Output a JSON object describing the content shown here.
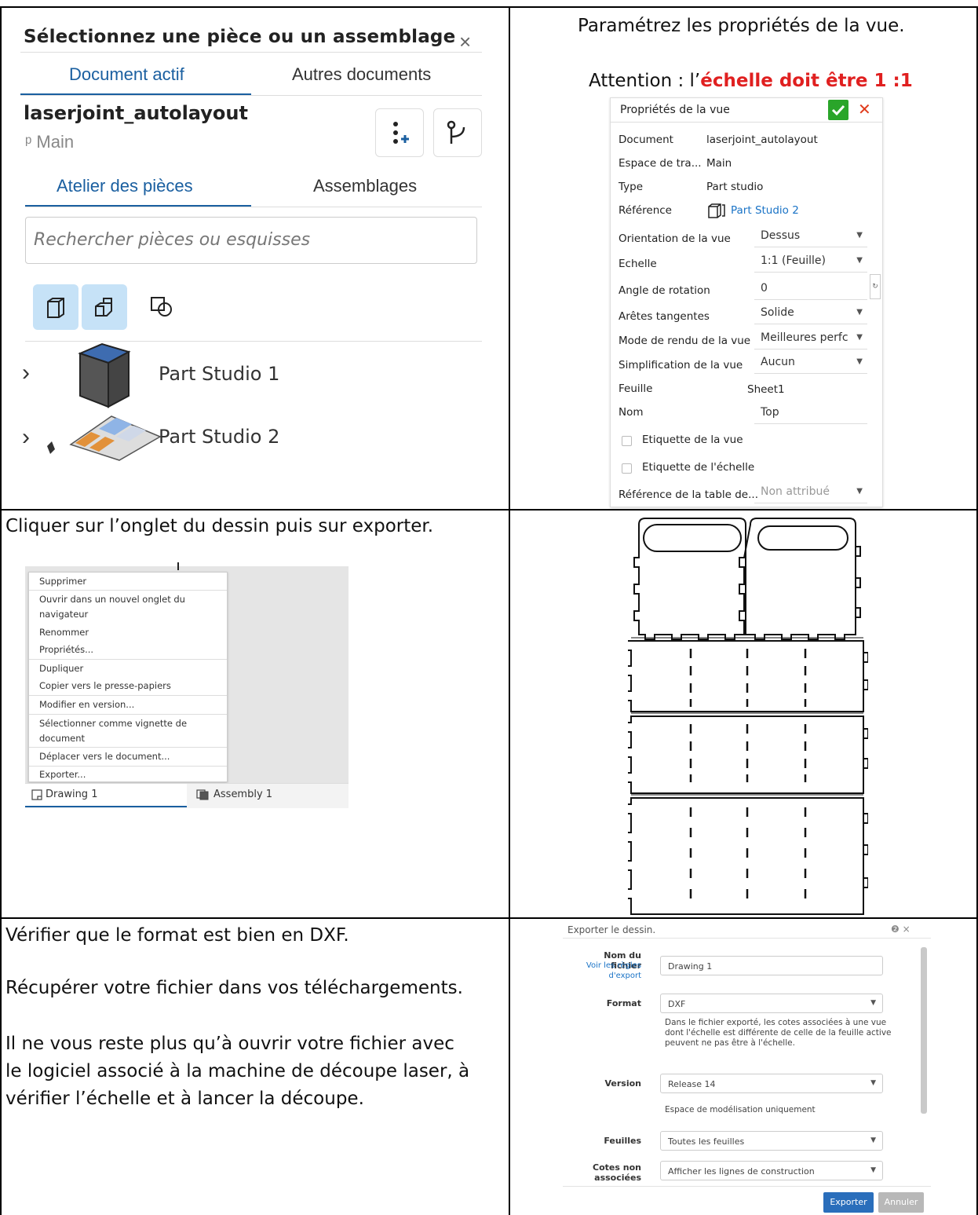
{
  "row1_left": {
    "title": "Sélectionnez une pièce ou un assemblage",
    "close": "×",
    "tabs": [
      "Document actif",
      "Autres documents"
    ],
    "document_name": "laserjoint_autolayout",
    "branch": "ᵖ Main",
    "subtabs": [
      "Atelier des pièces",
      "Assemblages"
    ],
    "search_placeholder": "Rechercher pièces ou esquisses",
    "items": [
      {
        "label": "Part Studio 1",
        "chevron": "›"
      },
      {
        "label": "Part Studio 2",
        "chevron": "›"
      }
    ]
  },
  "row1_right": {
    "intro": "Paramétrez les propriétés de la vue.",
    "attention_prefix": "Attention : l’",
    "attention_highlight": "échelle doit être 1 :1",
    "highlight_color": "#e02020",
    "panel": {
      "title": "Propriétés de la vue",
      "info_rows": [
        {
          "label": "Document",
          "value": "laserjoint_autolayout"
        },
        {
          "label": "Espace de tra...",
          "value": "Main"
        },
        {
          "label": "Type",
          "value": "Part studio"
        },
        {
          "label": "Référence",
          "value": "Part Studio 2"
        }
      ],
      "select_rows": [
        {
          "label": "Orientation de la vue",
          "value": "Dessus"
        },
        {
          "label": "Echelle",
          "value": "1:1 (Feuille)"
        },
        {
          "label": "Angle de rotation",
          "value": "0"
        },
        {
          "label": "Arêtes tangentes",
          "value": "Solide"
        },
        {
          "label": "Mode de rendu de la vue",
          "value": "Meilleures perfc"
        },
        {
          "label": "Simplification de la vue",
          "value": "Aucun"
        },
        {
          "label": "Feuille",
          "value": "Sheet1"
        },
        {
          "label": "Nom",
          "value": "Top"
        }
      ],
      "checkboxes": [
        "Etiquette de la vue",
        "Etiquette de l'échelle"
      ],
      "last_row": {
        "label": "Référence de la table de...",
        "value": "Non attribué"
      }
    }
  },
  "row2_left": {
    "instruction": "Cliquer sur l’onglet du dessin puis sur exporter.",
    "menu": [
      "Supprimer",
      "Ouvrir dans un nouvel onglet du",
      "navigateur",
      "Renommer",
      "Propriétés...",
      "Dupliquer",
      "Copier vers le presse-papiers",
      "Modifier en version...",
      "Sélectionner comme vignette de",
      "document",
      "Déplacer vers le document...",
      "Exporter..."
    ],
    "tabs": [
      "Drawing 1",
      "Assembly 1"
    ]
  },
  "row3_left": {
    "p1": "Vérifier que le format est bien en DXF.",
    "p2": "Récupérer votre fichier dans vos téléchargements.",
    "p3_line1": "Il ne vous reste plus qu’à ouvrir votre fichier avec",
    "p3_line2": "le logiciel associé à la machine de découpe laser, à",
    "p3_line3": "vérifier l’échelle et à lancer la découpe."
  },
  "export_dialog": {
    "title": "Exporter le dessin.",
    "icons": "❷ ×",
    "filename_label": "Nom du fichier",
    "rules_link_1": "Voir les règles",
    "rules_link_2": "d'export",
    "filename": "Drawing 1",
    "format_label": "Format",
    "format": "DXF",
    "format_note_1": "Dans le fichier exporté, les cotes associées à une vue",
    "format_note_2": "dont l'échelle est différente de celle de la feuille active",
    "format_note_3": "peuvent ne pas être à l'échelle.",
    "version_label": "Version",
    "version": "Release 14",
    "version_note": "Espace de modélisation uniquement",
    "sheets_label": "Feuilles",
    "sheets": "Toutes les feuilles",
    "dims_label_1": "Cotes non",
    "dims_label_2": "associées",
    "dims": "Afficher les lignes de construction",
    "export_button": "Exporter",
    "cancel_button": "Annuler",
    "accent": "#2a6ebb"
  }
}
